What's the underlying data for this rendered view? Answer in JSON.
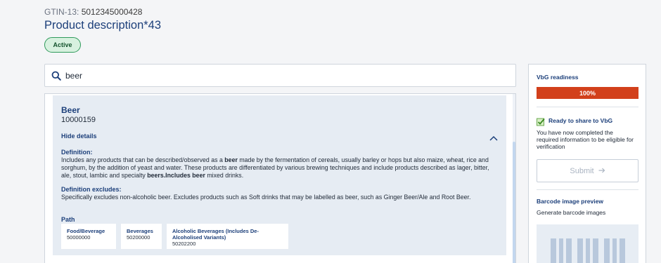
{
  "header": {
    "gtin_label": "GTIN-13:",
    "gtin_value": "5012345000428",
    "title": "Product description*43",
    "status": "Active"
  },
  "search": {
    "value": "beer",
    "placeholder": ""
  },
  "result": {
    "name": "Beer",
    "code": "10000159",
    "toggle_label": "Hide details",
    "definition_heading": "Definition:",
    "definition": [
      {
        "t": "Includes any products that can be described/observed as a ",
        "b": false
      },
      {
        "t": "beer",
        "b": true
      },
      {
        "t": " made by the fermentation of cereals, usually barley or hops but also maize, wheat, rice and sorghum, by the addition of yeast and water. These products are differentiated by various brewing techniques and include products described as lager, bitter, ale, stout, lambic and specialty ",
        "b": false
      },
      {
        "t": "beers.Includes beer",
        "b": true
      },
      {
        "t": " mixed drinks.",
        "b": false
      }
    ],
    "excludes_heading": "Definition excludes:",
    "excludes": "Specifically excludes non-alcoholic beer. Excludes products such as Soft drinks that may be labelled as beer, such as Ginger Beer/Ale and Root Beer.",
    "path_heading": "Path",
    "path": [
      {
        "title": "Food/Beverage",
        "code": "50000000"
      },
      {
        "title": "Beverages",
        "code": "50200000"
      },
      {
        "title": "Alcoholic Beverages (Includes De-Alcoholised Variants)",
        "code": "50202200"
      }
    ]
  },
  "sidebar": {
    "readiness_title": "VbG readiness",
    "readiness_value": "100%",
    "readiness_fraction": 1.0,
    "ready_label": "Ready to share to VbG",
    "ready_message": "You have now completed the required information to be eligible for verification",
    "submit_label": "Submit",
    "barcode_title": "Barcode image preview",
    "barcode_subtitle": "Generate barcode images"
  },
  "colors": {
    "accent": "#1c3f7a",
    "status_green": "#2f9a5b",
    "readiness_bar": "#d2401b"
  },
  "icons": {
    "search": "search-icon",
    "chevron": "chevron-up-icon",
    "check": "check-box-icon",
    "submit_arrow": "arrow-right-icon"
  }
}
